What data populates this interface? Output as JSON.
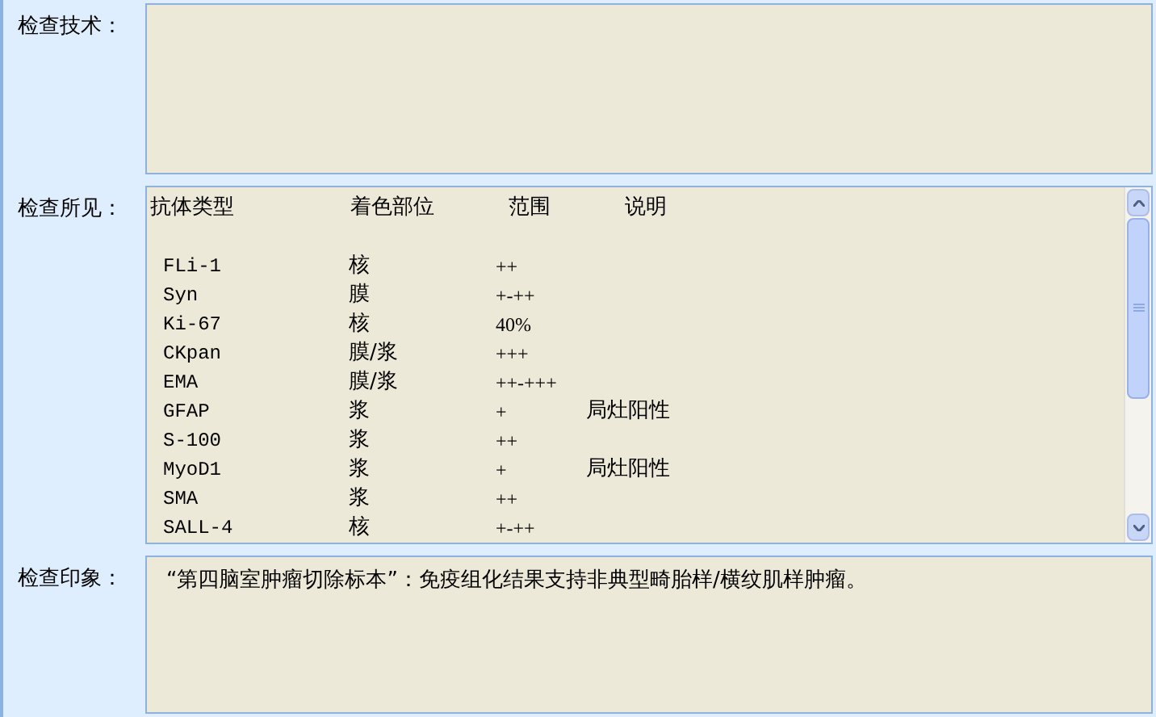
{
  "sections": [
    {
      "kind": "text",
      "label": "检查技术："
    },
    {
      "kind": "table",
      "label": "检查所见：",
      "columns": [
        "抗体类型",
        "着色部位",
        "范围",
        "说明"
      ],
      "rows": [
        {
          "antibody": "FLi-1",
          "site": "核",
          "range": "++"
        },
        {
          "antibody": "Syn",
          "site": "膜",
          "range": "+-++"
        },
        {
          "antibody": "Ki-67",
          "site": "核",
          "range": "40%"
        },
        {
          "antibody": "CKpan",
          "site": "膜/浆",
          "range": "+++"
        },
        {
          "antibody": "EMA",
          "site": "膜/浆",
          "range": "++-+++"
        },
        {
          "antibody": "GFAP",
          "site": "浆",
          "range": "+",
          "note": "局灶阳性"
        },
        {
          "antibody": "S-100",
          "site": "浆",
          "range": "++"
        },
        {
          "antibody": "MyoD1",
          "site": "浆",
          "range": "+",
          "note": "局灶阳性"
        },
        {
          "antibody": "SMA",
          "site": "浆",
          "range": "++"
        },
        {
          "antibody": "SALL-4",
          "site": "核",
          "range": "+-++"
        }
      ]
    },
    {
      "kind": "text",
      "label": "检查印象：",
      "value": "“第四脑室肿瘤切除标本”：免疫组化结果支持非典型畸胎样/横纹肌样肿瘤。"
    }
  ]
}
